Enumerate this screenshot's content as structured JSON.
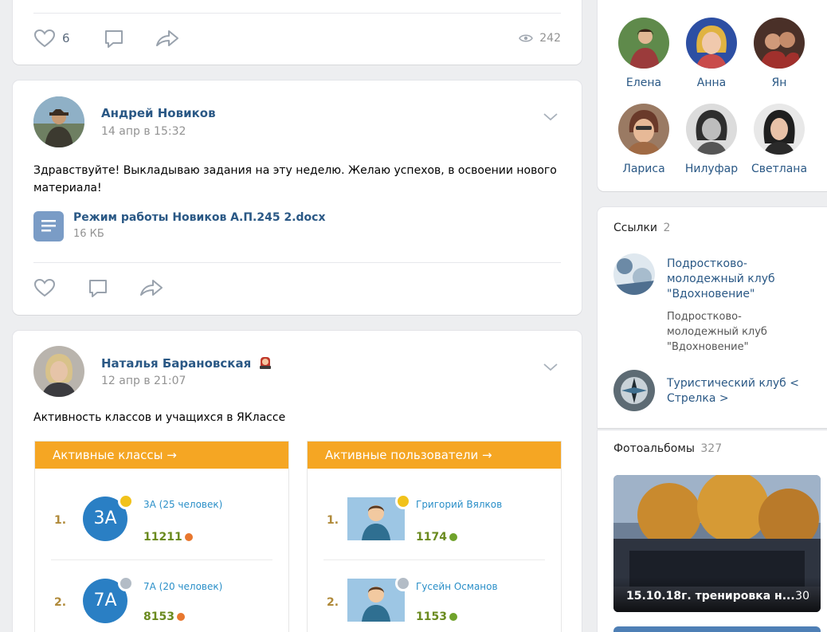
{
  "post_prev": {
    "likes": "6",
    "views": "242"
  },
  "post1": {
    "author": "Андрей Новиков",
    "date": "14 апр в 15:32",
    "text": "Здравствуйте! Выкладываю задания на эту неделю. Желаю успехов, в освоении нового материала!",
    "attachment": {
      "name": "Режим работы Новиков А.П.245 2.docx",
      "size": "16 КБ"
    }
  },
  "post2": {
    "author": "Наталья Барановская",
    "date": "12 апр в 21:07",
    "text": "Активность классов и учащихся в ЯКлассе",
    "classes_header": "Активные классы →",
    "users_header": "Активные пользователи →",
    "classes": [
      {
        "rank": "1.",
        "badge": "3А",
        "name": "3А (25 человек)",
        "score": "11211"
      },
      {
        "rank": "2.",
        "badge": "7А",
        "name": "7А (20 человек)",
        "score": "8153"
      }
    ],
    "users": [
      {
        "rank": "1.",
        "name": "Григорий Вялков",
        "score": "1174"
      },
      {
        "rank": "2.",
        "name": "Гусейн Османов",
        "score": "1153"
      }
    ]
  },
  "friends": [
    {
      "name": "Елена"
    },
    {
      "name": "Анна"
    },
    {
      "name": "Ян"
    },
    {
      "name": "Лариса"
    },
    {
      "name": "Нилуфар"
    },
    {
      "name": "Светлана"
    }
  ],
  "links": {
    "title": "Ссылки",
    "count": "2",
    "items": [
      {
        "title": "Подростково-молодежный клуб \"Вдохновение\"",
        "desc": "Подростково-молодежный клуб \"Вдохновение\""
      },
      {
        "title": "Туристический клуб < Стрелка >",
        "desc": ""
      }
    ]
  },
  "albums": {
    "title": "Фотоальбомы",
    "count": "327",
    "first": {
      "caption": "15.10.18г. тренировка н...",
      "count": "30"
    }
  }
}
